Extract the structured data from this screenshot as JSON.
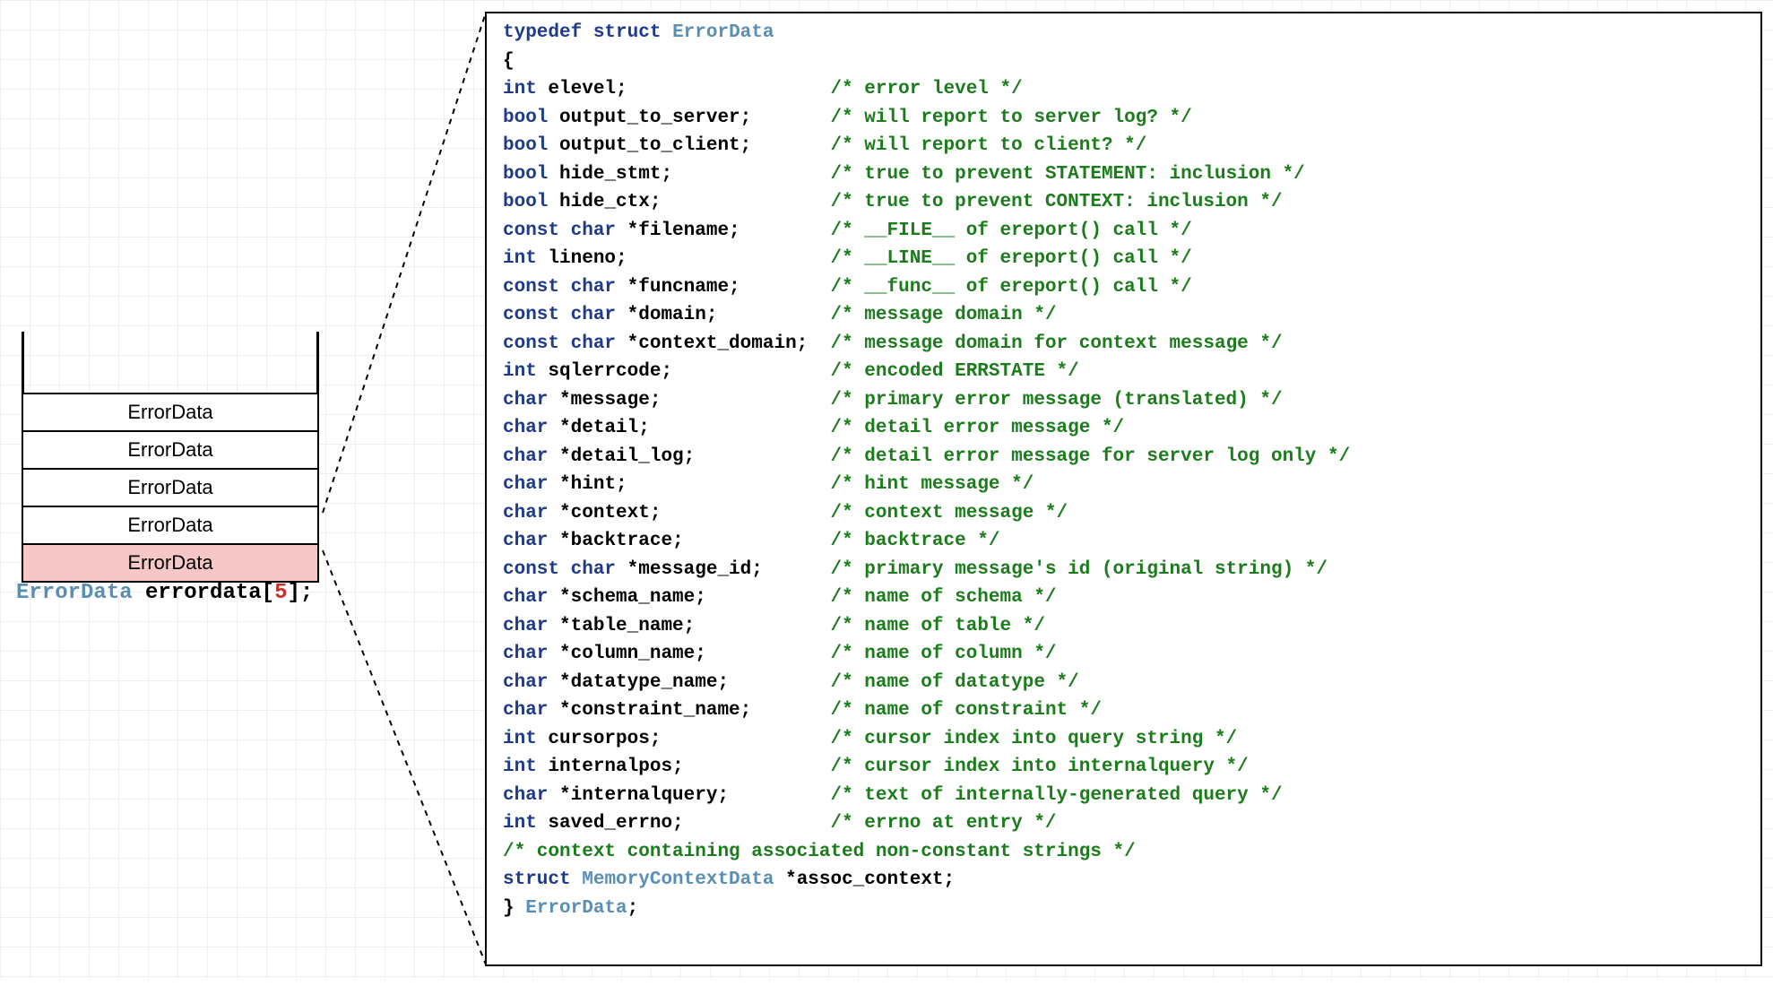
{
  "stack": {
    "items": [
      "ErrorData",
      "ErrorData",
      "ErrorData",
      "ErrorData",
      "ErrorData"
    ]
  },
  "arr": {
    "type": "ErrorData",
    "name": "errordata",
    "size": "5",
    "tail": ";"
  },
  "code": {
    "typedef_kw": "typedef",
    "struct_kw": "struct",
    "struct_name": "ErrorData",
    "open": "{",
    "fields": [
      {
        "type": "int",
        "name": "elevel;",
        "cmt": "/* error level */"
      },
      {
        "type": "bool",
        "name": "output_to_server;",
        "cmt": "/* will report to server log? */"
      },
      {
        "type": "bool",
        "name": "output_to_client;",
        "cmt": "/* will report to client? */"
      },
      {
        "type": "bool",
        "name": "hide_stmt;",
        "cmt": "/* true to prevent STATEMENT: inclusion */"
      },
      {
        "type": "bool",
        "name": "hide_ctx;",
        "cmt": "/* true to prevent CONTEXT: inclusion */"
      },
      {
        "type": "const char",
        "name": "*filename;",
        "cmt": "/* __FILE__ of ereport() call */"
      },
      {
        "type": "int",
        "name": "lineno;",
        "cmt": "/* __LINE__ of ereport() call */"
      },
      {
        "type": "const char",
        "name": "*funcname;",
        "cmt": "/* __func__ of ereport() call */"
      },
      {
        "type": "const char",
        "name": "*domain;",
        "cmt": "/* message domain */"
      },
      {
        "type": "const char",
        "name": "*context_domain;",
        "cmt": "/* message domain for context message */"
      },
      {
        "type": "int",
        "name": "sqlerrcode;",
        "cmt": "/* encoded ERRSTATE */"
      },
      {
        "type": "char",
        "name": "*message;",
        "cmt": "/* primary error message (translated) */"
      },
      {
        "type": "char",
        "name": "*detail;",
        "cmt": "/* detail error message */"
      },
      {
        "type": "char",
        "name": "*detail_log;",
        "cmt": "/* detail error message for server log only */"
      },
      {
        "type": "char",
        "name": "*hint;",
        "cmt": "/* hint message */"
      },
      {
        "type": "char",
        "name": "*context;",
        "cmt": "/* context message */"
      },
      {
        "type": "char",
        "name": "*backtrace;",
        "cmt": "/* backtrace */"
      },
      {
        "type": "const char",
        "name": "*message_id;",
        "cmt": "/* primary message's id (original string) */"
      },
      {
        "type": "char",
        "name": "*schema_name;",
        "cmt": "/* name of schema */"
      },
      {
        "type": "char",
        "name": "*table_name;",
        "cmt": "/* name of table */"
      },
      {
        "type": "char",
        "name": "*column_name;",
        "cmt": "/* name of column */"
      },
      {
        "type": "char",
        "name": "*datatype_name;",
        "cmt": "/* name of datatype */"
      },
      {
        "type": "char",
        "name": "*constraint_name;",
        "cmt": "/* name of constraint */"
      },
      {
        "type": "int",
        "name": "cursorpos;",
        "cmt": "/* cursor index into query string */"
      },
      {
        "type": "int",
        "name": "internalpos;",
        "cmt": "/* cursor index into internalquery */"
      },
      {
        "type": "char",
        "name": "*internalquery;",
        "cmt": "/* text of internally-generated query */"
      },
      {
        "type": "int",
        "name": "saved_errno;",
        "cmt": "/* errno at entry */"
      }
    ],
    "blank": "",
    "tail_cmt": "/* context containing associated non-constant strings */",
    "tail_struct_kw": "struct",
    "tail_struct_ty": "MemoryContextData",
    "tail_struct_name": "*assoc_context;",
    "close": "}",
    "close_ty": "ErrorData",
    "close_tail": ";"
  }
}
